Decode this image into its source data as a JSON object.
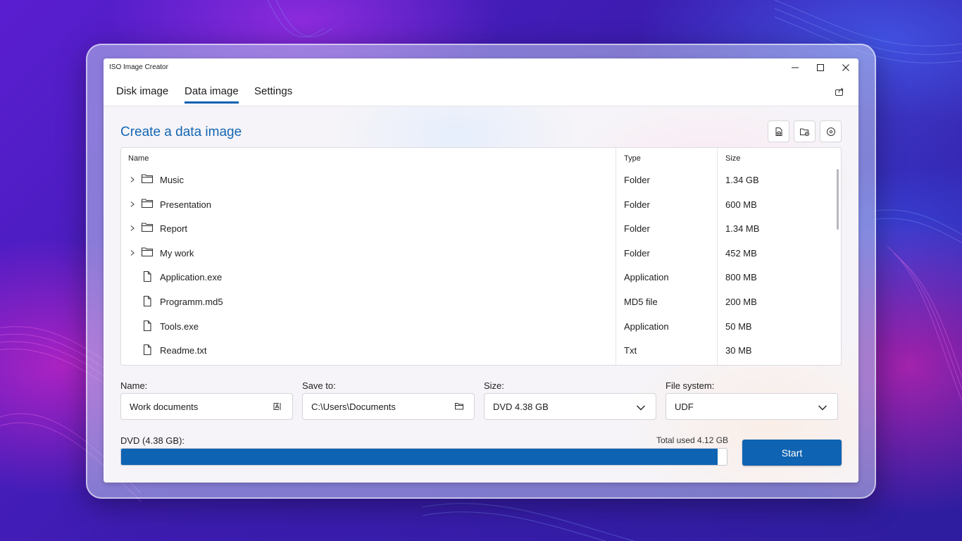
{
  "window": {
    "title": "ISO Image Creator"
  },
  "tabs": [
    {
      "label": "Disk image",
      "active": false
    },
    {
      "label": "Data image",
      "active": true
    },
    {
      "label": "Settings",
      "active": false
    }
  ],
  "page": {
    "title": "Create a data image"
  },
  "toolbar": {
    "buttons": [
      "add-file-icon",
      "add-folder-icon",
      "disc-icon"
    ]
  },
  "table": {
    "columns": [
      "Name",
      "Type",
      "Size"
    ],
    "rows": [
      {
        "name": "Music",
        "type": "Folder",
        "size": "1.34 GB",
        "kind": "folder"
      },
      {
        "name": "Presentation",
        "type": "Folder",
        "size": "600 MB",
        "kind": "folder"
      },
      {
        "name": "Report",
        "type": "Folder",
        "size": "1.34 MB",
        "kind": "folder"
      },
      {
        "name": "My work",
        "type": "Folder",
        "size": "452 MB",
        "kind": "folder"
      },
      {
        "name": "Application.exe",
        "type": "Application",
        "size": "800 MB",
        "kind": "file"
      },
      {
        "name": "Programm.md5",
        "type": "MD5 file",
        "size": "200 MB",
        "kind": "file"
      },
      {
        "name": "Tools.exe",
        "type": "Application",
        "size": "50 MB",
        "kind": "file"
      },
      {
        "name": "Readme.txt",
        "type": "Txt",
        "size": "30 MB",
        "kind": "file"
      }
    ]
  },
  "form": {
    "name_label": "Name:",
    "name_value": "Work documents",
    "save_label": "Save to:",
    "save_value": "C:\\Users\\Documents",
    "size_label": "Size:",
    "size_value": "DVD 4.38 GB",
    "fs_label": "File system:",
    "fs_value": "UDF"
  },
  "progress": {
    "label": "DVD (4.38 GB):",
    "total_used": "Total used 4.12 GB",
    "fraction": 0.985
  },
  "start_label": "Start",
  "colors": {
    "accent": "#0e63b2",
    "title_blue": "#1566b3"
  }
}
